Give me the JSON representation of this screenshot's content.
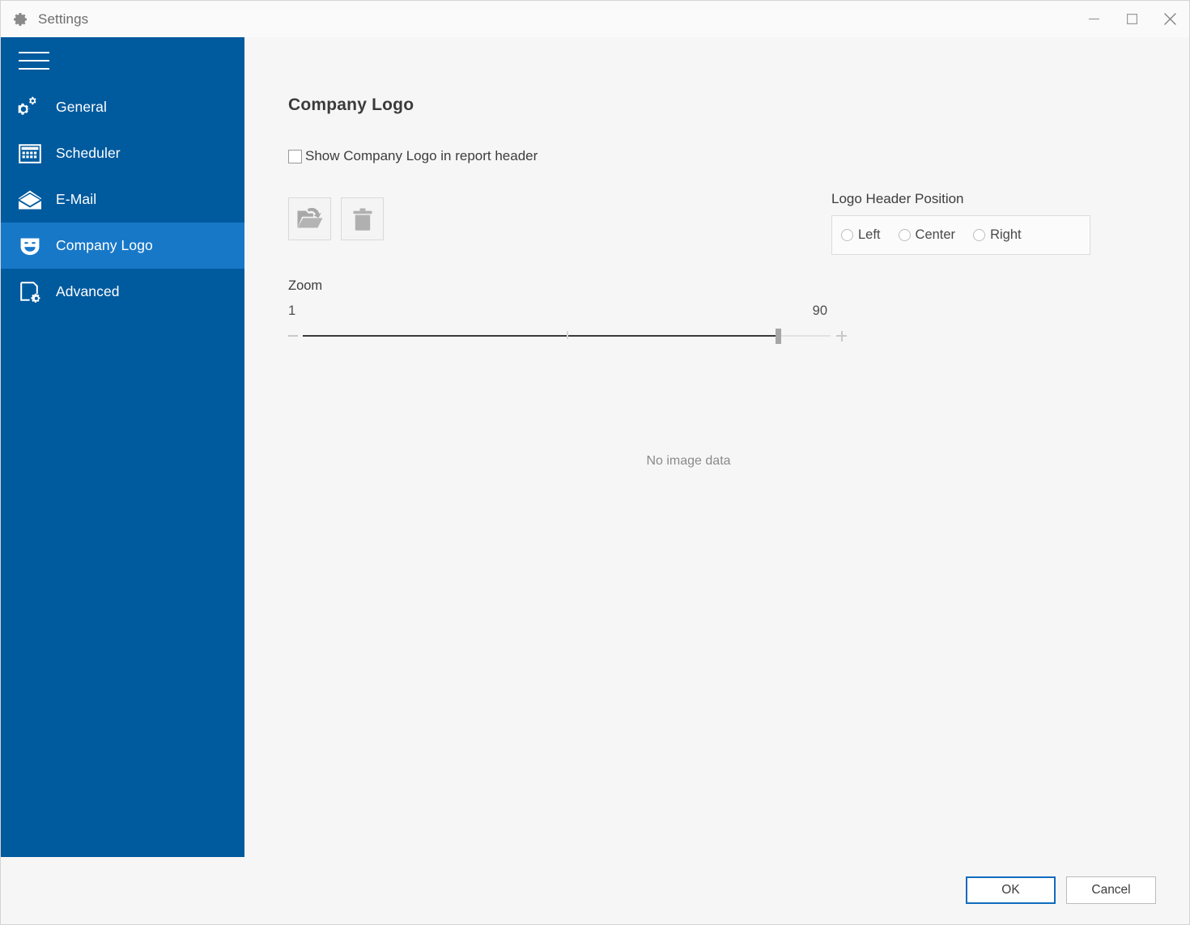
{
  "window": {
    "title": "Settings",
    "title_icon": "gear-icon",
    "controls": {
      "minimize": "minimize-icon",
      "maximize": "maximize-icon",
      "close": "close-icon"
    }
  },
  "sidebar": {
    "menu_icon": "hamburger-icon",
    "accent_color": "#005a9e",
    "selected_color": "#1878c8",
    "selected_index": 3,
    "items": [
      {
        "label": "General",
        "icon": "gears-icon"
      },
      {
        "label": "Scheduler",
        "icon": "calendar-icon"
      },
      {
        "label": "E-Mail",
        "icon": "envelope-icon"
      },
      {
        "label": "Company Logo",
        "icon": "mask-smiley-icon"
      },
      {
        "label": "Advanced",
        "icon": "page-gear-icon"
      }
    ]
  },
  "main": {
    "page_title": "Company Logo",
    "show_logo_checkbox": {
      "label": "Show Company Logo in report header",
      "checked": false
    },
    "tool_buttons": [
      {
        "name": "open-image-button",
        "icon": "open-folder-icon"
      },
      {
        "name": "delete-image-button",
        "icon": "trash-icon"
      }
    ],
    "position_group": {
      "label": "Logo Header Position",
      "options": [
        {
          "label": "Left",
          "selected": false
        },
        {
          "label": "Center",
          "selected": false
        },
        {
          "label": "Right",
          "selected": false
        }
      ]
    },
    "zoom": {
      "label": "Zoom",
      "min_label": "1",
      "max_label": "90",
      "min": 1,
      "max": 100,
      "value": 90,
      "percent": 90
    },
    "preview_placeholder": "No image data"
  },
  "footer": {
    "ok_label": "OK",
    "cancel_label": "Cancel"
  }
}
